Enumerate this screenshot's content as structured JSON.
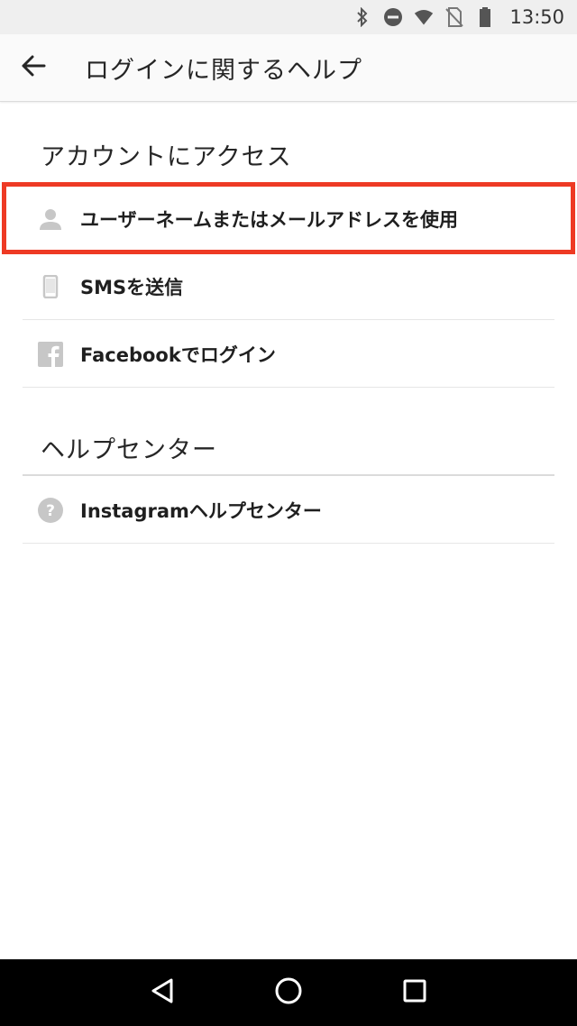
{
  "status_bar": {
    "time": "13:50",
    "icons": [
      "bluetooth-icon",
      "do-not-disturb-icon",
      "wifi-icon",
      "no-sim-icon",
      "battery-icon"
    ]
  },
  "app_bar": {
    "title": "ログインに関するヘルプ",
    "back_icon": "arrow-left-icon"
  },
  "sections": {
    "account_access": {
      "header": "アカウントにアクセス",
      "items": [
        {
          "label": "ユーザーネームまたはメールアドレスを使用",
          "icon": "person-icon"
        },
        {
          "label": "SMSを送信",
          "icon": "phone-icon"
        },
        {
          "label": "Facebookでログイン",
          "icon": "facebook-icon"
        }
      ]
    },
    "help_center": {
      "header": "ヘルプセンター",
      "items": [
        {
          "label": "Instagramヘルプセンター",
          "icon": "help-icon"
        }
      ]
    }
  },
  "colors": {
    "highlight": "#ee3a24",
    "icon_gray": "#c7c7c7"
  },
  "nav_bar": {
    "icons": [
      "back-triangle-icon",
      "home-circle-icon",
      "recents-square-icon"
    ]
  }
}
